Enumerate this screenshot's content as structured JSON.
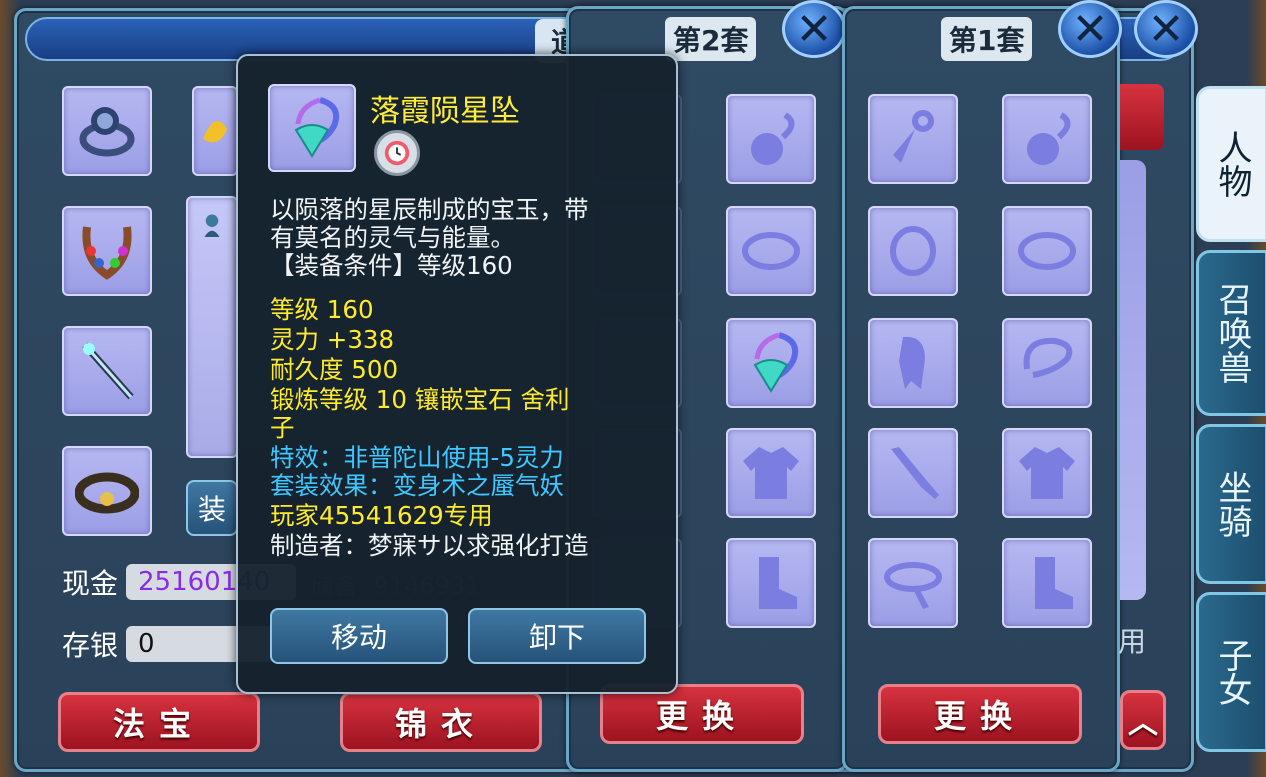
{
  "main_panel": {
    "title": "道",
    "partial_button_label": "装",
    "cash": {
      "label": "现金",
      "value": "25160140"
    },
    "storage": {
      "label": "储备",
      "value": "9146931"
    },
    "deposit": {
      "label": "存银",
      "value": "0"
    },
    "buttons": [
      "法宝",
      "锦衣"
    ]
  },
  "set2": {
    "title": "第2套",
    "swap_label": "更换"
  },
  "set1": {
    "title": "第1套",
    "swap_label": "更换"
  },
  "partial_text": "用",
  "side_tabs": [
    "人物",
    "召唤兽",
    "坐骑",
    "子女"
  ],
  "tooltip": {
    "item_name": "落霞陨星坠",
    "desc1": "以陨落的星辰制成的宝玉，带",
    "desc2": "有莫名的灵气与能量。",
    "desc3": "【装备条件】等级160",
    "stat_level": "等级 160",
    "stat_spirit": "灵力 +338",
    "stat_durability": "耐久度 500",
    "stat_forge": "锻炼等级 10  镶嵌宝石 舍利",
    "stat_forge2": "子",
    "effect": "特效：非普陀山使用-5灵力",
    "set_effect": "套装效果：变身术之蜃气妖",
    "player": "玩家45541629专用",
    "maker": "制造者：梦寐サ以求强化打造",
    "btn_move": "移动",
    "btn_unequip": "卸下"
  },
  "colors": {
    "name": "#ffec3a",
    "yellow_stats": "#ffea2e",
    "blue_stats": "#3ec8ff",
    "red_button": "#c02230"
  }
}
